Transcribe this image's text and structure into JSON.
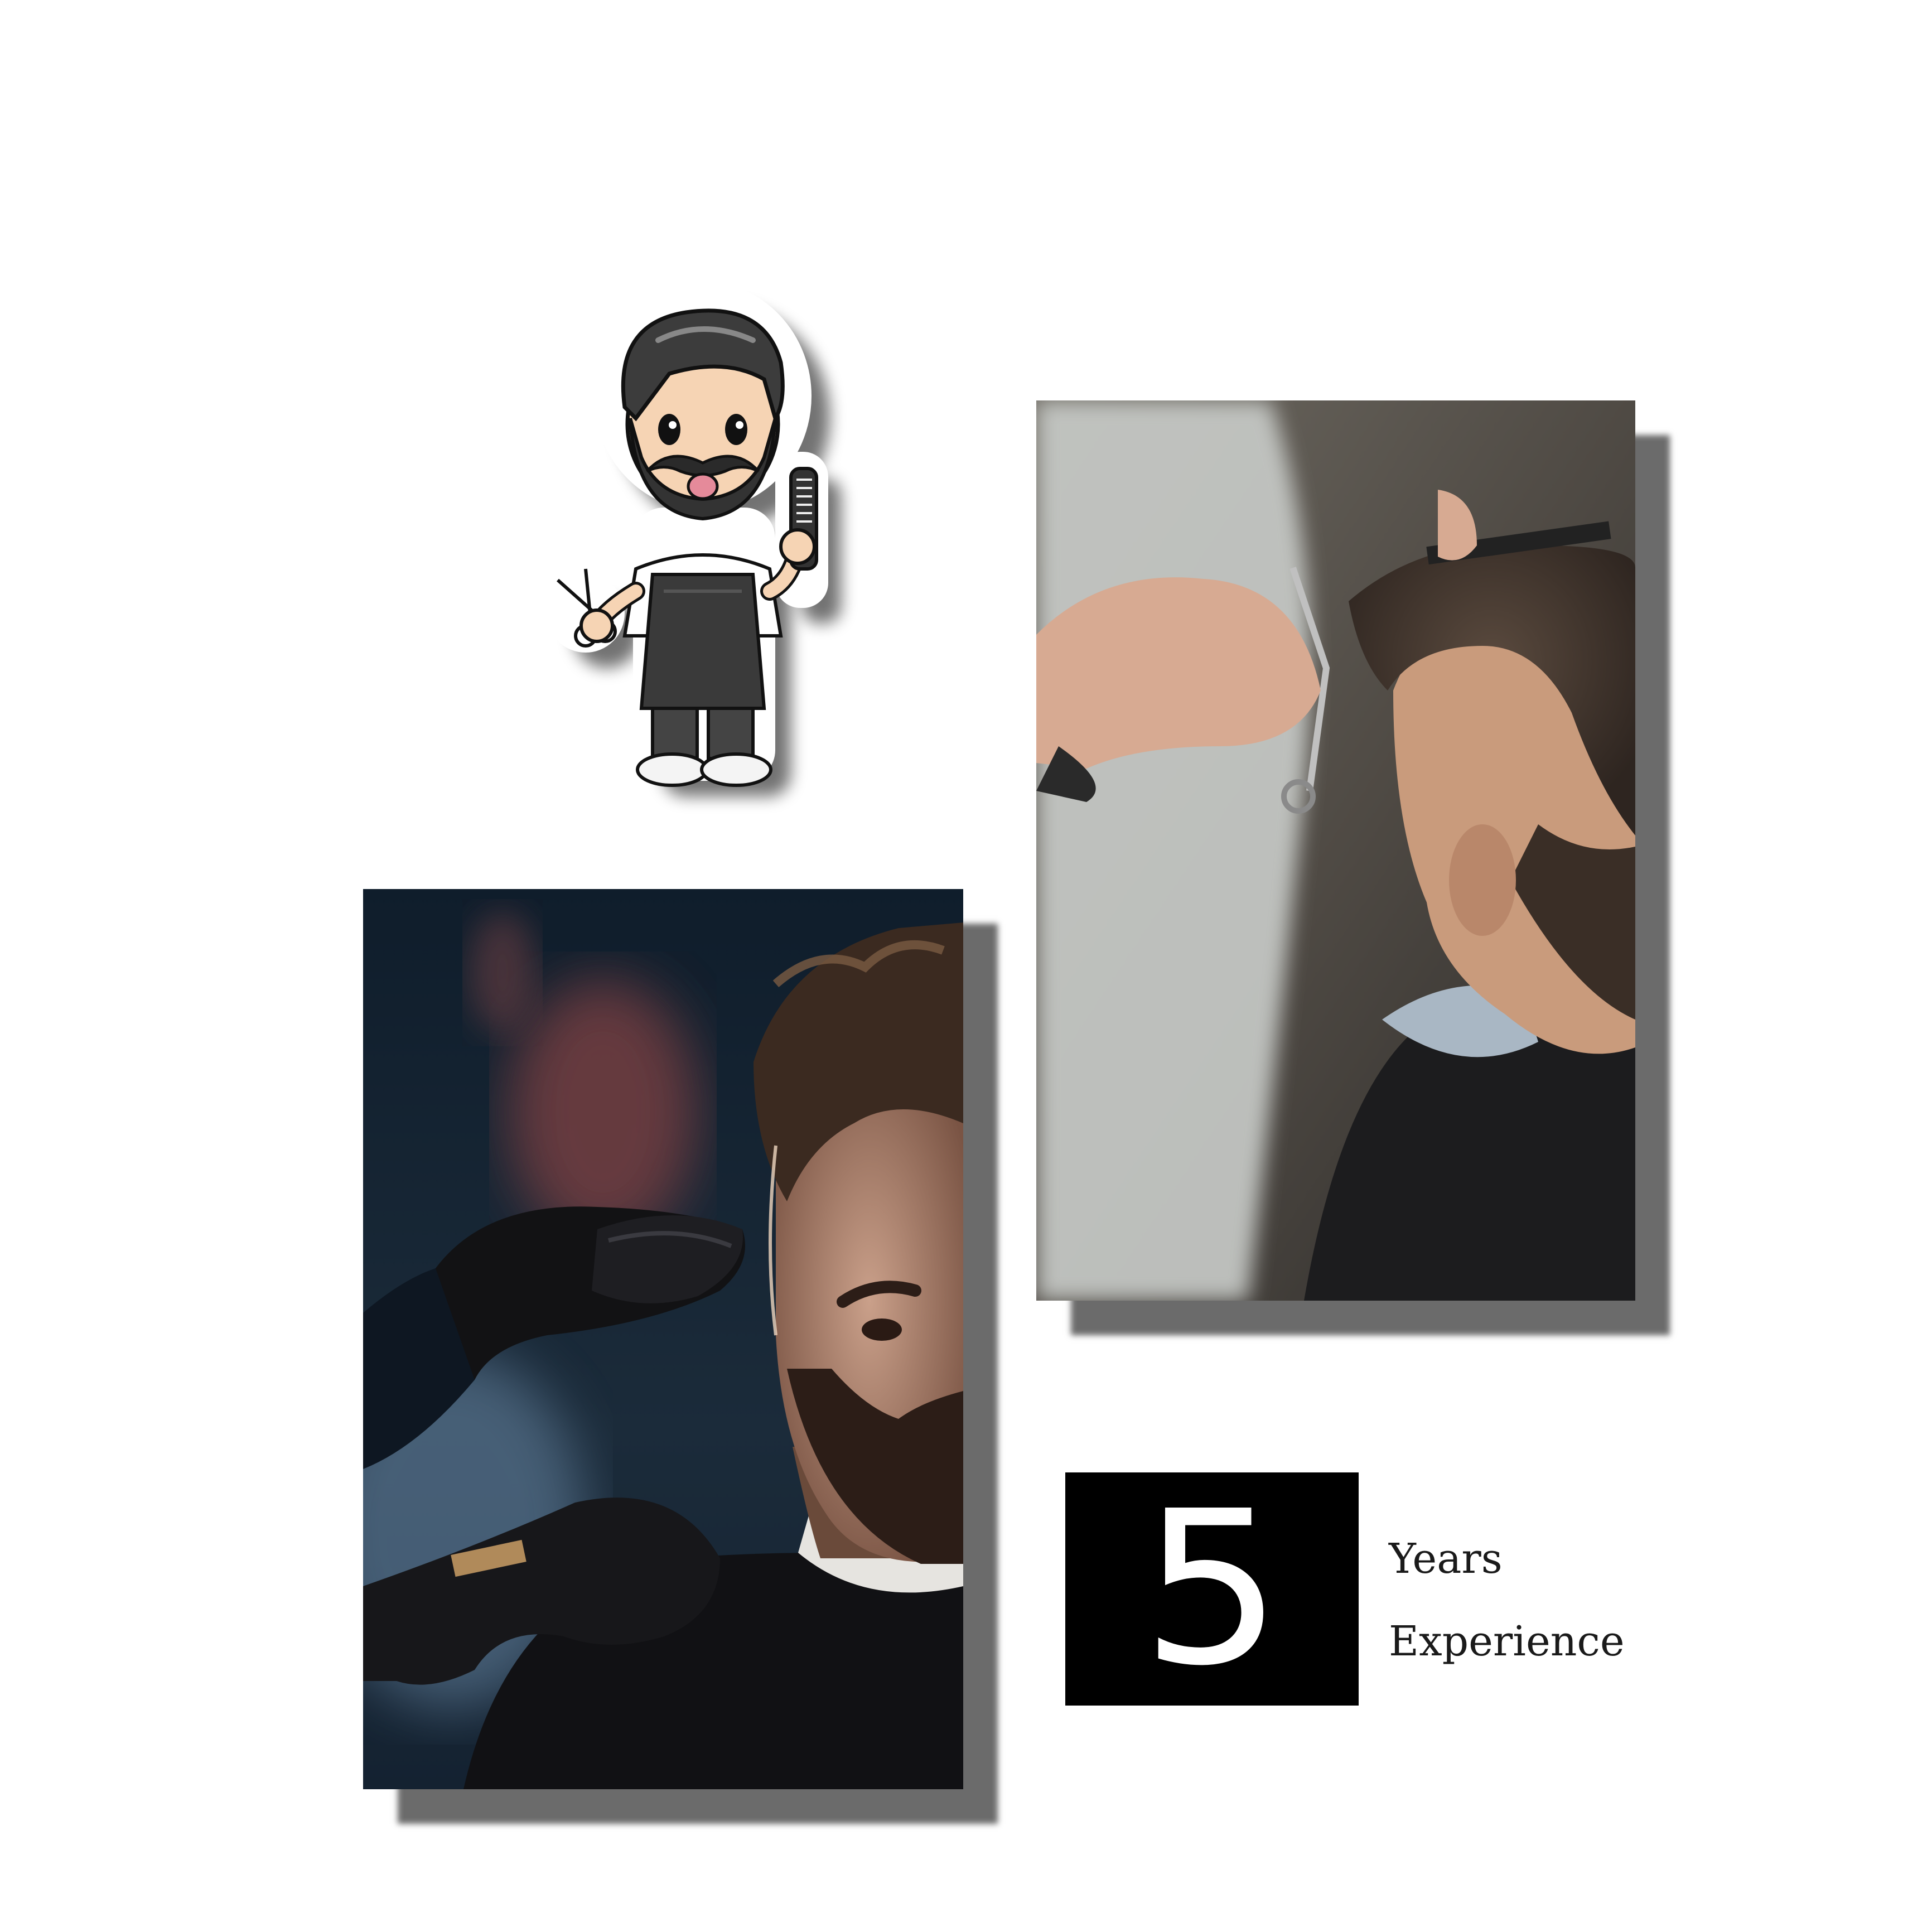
{
  "experience": {
    "number": "5",
    "label_line_1": "Years",
    "label_line_2": "Experience"
  },
  "colors": {
    "background": "#ffffff",
    "stat_box": "#000000",
    "stat_number": "#ffffff",
    "label_text": "#1a1a1a"
  },
  "images": {
    "mascot": "cartoon-barber-mascot",
    "photo_top": "barber-cutting-hair-with-scissors-and-comb",
    "photo_bottom": "bearded-man-receiving-clipper-haircut"
  }
}
